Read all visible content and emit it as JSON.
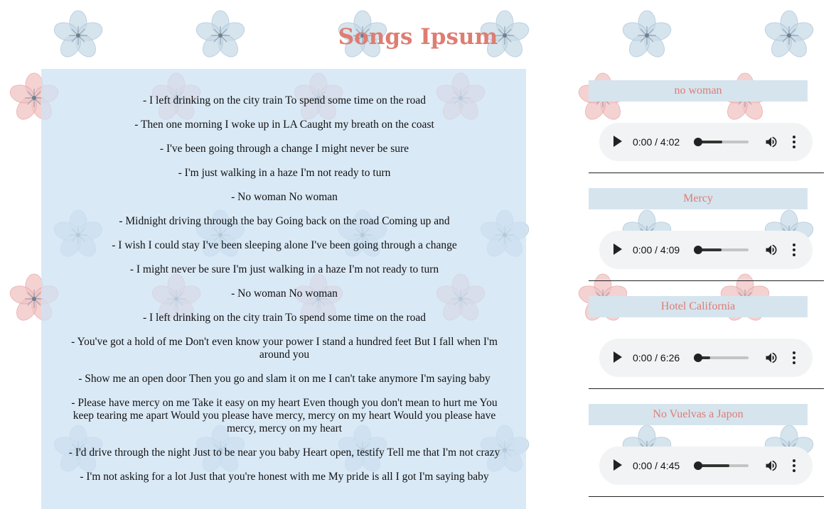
{
  "page": {
    "title": "Songs Ipsum"
  },
  "lyrics": [
    "- I left drinking on the city train To spend some time on the road",
    "- Then one morning I woke up in LA Caught my breath on the coast",
    "- I've been going through a change I might never be sure",
    "- I'm just walking in a haze I'm not ready to turn",
    "- No woman No woman",
    "- Midnight driving through the bay Going back on the road Coming up and",
    "- I wish I could stay I've been sleeping alone I've been going through a change",
    "- I might never be sure I'm just walking in a haze I'm not ready to turn",
    "- No woman No woman",
    "- I left drinking on the city train To spend some time on the road",
    "- You've got a hold of me Don't even know your power I stand a hundred feet But I fall when I'm around you",
    "- Show me an open door Then you go and slam it on me I can't take anymore I'm saying baby",
    "- Please have mercy on me Take it easy on my heart Even though you don't mean to hurt me You keep tearing me apart Would you please have mercy, mercy on my heart Would you please have mercy, mercy on my heart",
    "- I'd drive through the night Just to be near you baby Heart open, testify Tell me that I'm not crazy",
    "- I'm not asking for a lot Just that you're honest with me My pride is all I got I'm saying baby"
  ],
  "songs": [
    {
      "title": "no woman",
      "time": "0:00 / 4:02",
      "buffered": 0.52
    },
    {
      "title": "Mercy",
      "time": "0:00 / 4:09",
      "buffered": 0.5
    },
    {
      "title": "Hotel California",
      "time": "0:00 / 6:26",
      "buffered": 0.3
    },
    {
      "title": "No Vuelvas a Japon",
      "time": "0:00 / 4:45",
      "buffered": 0.65
    }
  ],
  "icons": {
    "play": "play-icon",
    "volume": "volume-icon",
    "menu": "more-vertical-icon",
    "decor": "flower-icon"
  },
  "colors": {
    "title": "#de7d72",
    "panel": "#cee1f3",
    "song_title_bg": "#d6e4ee",
    "player_bg": "#f1f3f4"
  }
}
